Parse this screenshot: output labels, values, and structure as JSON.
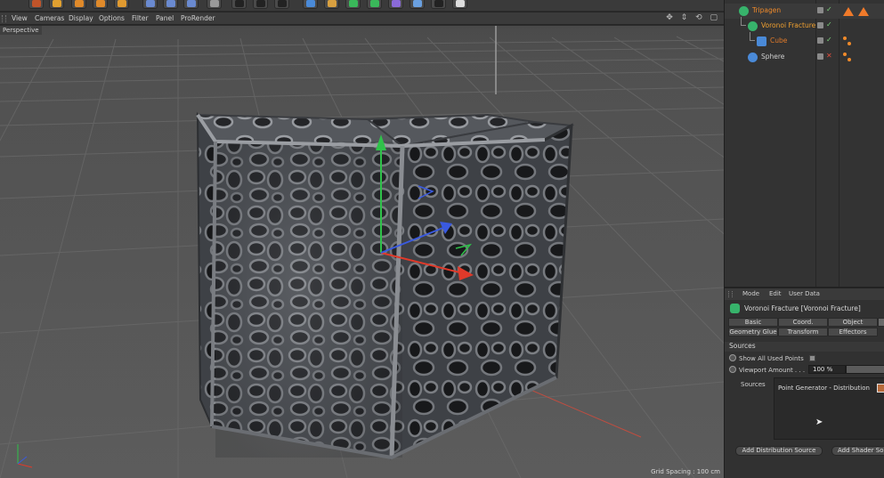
{
  "viewport_menu": [
    "View",
    "Cameras",
    "Display",
    "Options",
    "Filter",
    "Panel",
    "ProRender"
  ],
  "viewport": {
    "label": "Perspective",
    "grid_spacing": "Grid Spacing : 100 cm",
    "nav_glyphs": "✥ ⇕ ⟲ ▢"
  },
  "object_manager": {
    "objects": [
      {
        "name": "Tripagen",
        "color": "#f08a2a",
        "icon": "mograph-node-icon",
        "state": "enabled"
      },
      {
        "name": "Voronoi Fracture",
        "color": "#f0a030",
        "icon": "voronoi-fracture-icon",
        "state": "enabled"
      },
      {
        "name": "Cube",
        "color": "#e07a2a",
        "icon": "cube-icon",
        "state": "enabled"
      },
      {
        "name": "Sphere",
        "color": "#cfcfcf",
        "icon": "sphere-icon",
        "state": "disabled"
      }
    ]
  },
  "attribute_manager": {
    "menu": [
      "Mode",
      "Edit",
      "User Data"
    ],
    "object_title": "Voronoi Fracture [Voronoi Fracture]",
    "tabs_row1": [
      "Basic",
      "Coord.",
      "Object"
    ],
    "tabs_row2": [
      "Geometry Glue",
      "Transform",
      "Effectors"
    ],
    "section": "Sources",
    "show_all_used_points": "Show All Used Points",
    "viewport_amount_label": "Viewport Amount . . .",
    "viewport_amount_value": "100 %",
    "sources_label": "Sources",
    "sources_items": [
      "Point Generator - Distribution"
    ],
    "add_distribution_source": "Add Distribution Source",
    "add_shader_source": "Add Shader Sou"
  },
  "colors": {
    "accent_orange": "#f07a2a",
    "mograph_green": "#37b36b",
    "axis_x": "#e03a2a",
    "axis_y": "#2fc24a",
    "axis_z": "#3a5ae0"
  }
}
